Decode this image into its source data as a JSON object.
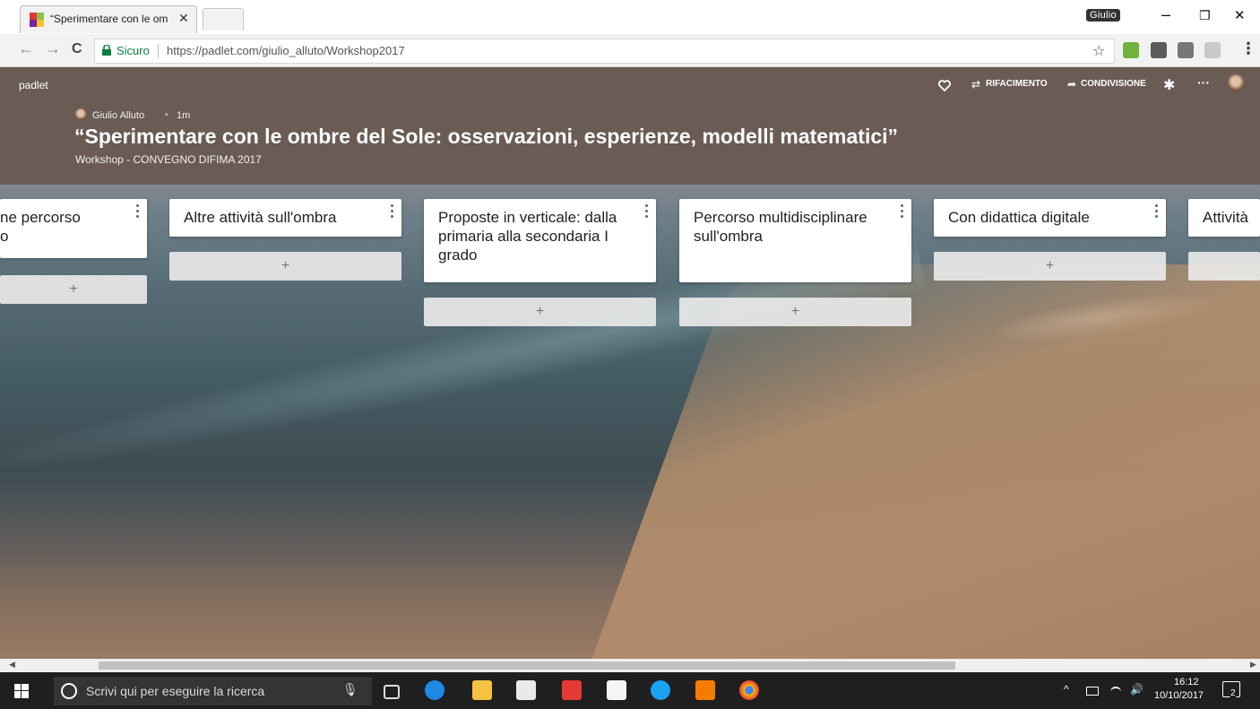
{
  "browser": {
    "tab_title": "“Sperimentare con le om",
    "tab_close": "✕",
    "user_label": "Giulio",
    "window_minimize": "–",
    "window_maximize": "❐",
    "window_close": "✕",
    "secure_label": "Sicuro",
    "url": "https://padlet.com/giulio_alluto/Workshop2017",
    "back": "←",
    "forward": "→",
    "reload": "C",
    "star": "☆",
    "menu": "⋮"
  },
  "padlet": {
    "logo": "padlet",
    "actions": {
      "remake_label": "RIFACIMENTO",
      "share_label": "CONDIVISIONE",
      "remake_icon": "⇄",
      "share_icon": "➦",
      "gear_icon": "✱",
      "more_icon": "···"
    },
    "author": "Giulio Alluto",
    "separator": "•",
    "time": "1m",
    "title": "“Sperimentare con le ombre del Sole: osservazioni, esperienze, modelli matematici”",
    "subtitle": "Workshop - CONVEGNO DIFIMA 2017",
    "columns": [
      {
        "title": "ne percorso\no"
      },
      {
        "title": "Altre attività sull'ombra"
      },
      {
        "title": "Proposte in verticale: dalla primaria alla secondaria I grado"
      },
      {
        "title": "Percorso multidisciplinare sull'ombra"
      },
      {
        "title": "Con didattica digitale"
      },
      {
        "title": "Attività"
      }
    ],
    "add_symbol": "+"
  },
  "scrollbar": {
    "left_arrow": "◀",
    "right_arrow": "▶"
  },
  "taskbar": {
    "search_placeholder": "Scrivi qui per eseguire la ricerca",
    "mic": "🎙",
    "time": "16:12",
    "date": "10/10/2017",
    "notifications": "2",
    "tray_up": "^",
    "volume": "🔊"
  },
  "colors": {
    "header_bg": "#6b5b55",
    "secure_green": "#0b8043",
    "taskbar_bg": "#1f1f1f"
  }
}
